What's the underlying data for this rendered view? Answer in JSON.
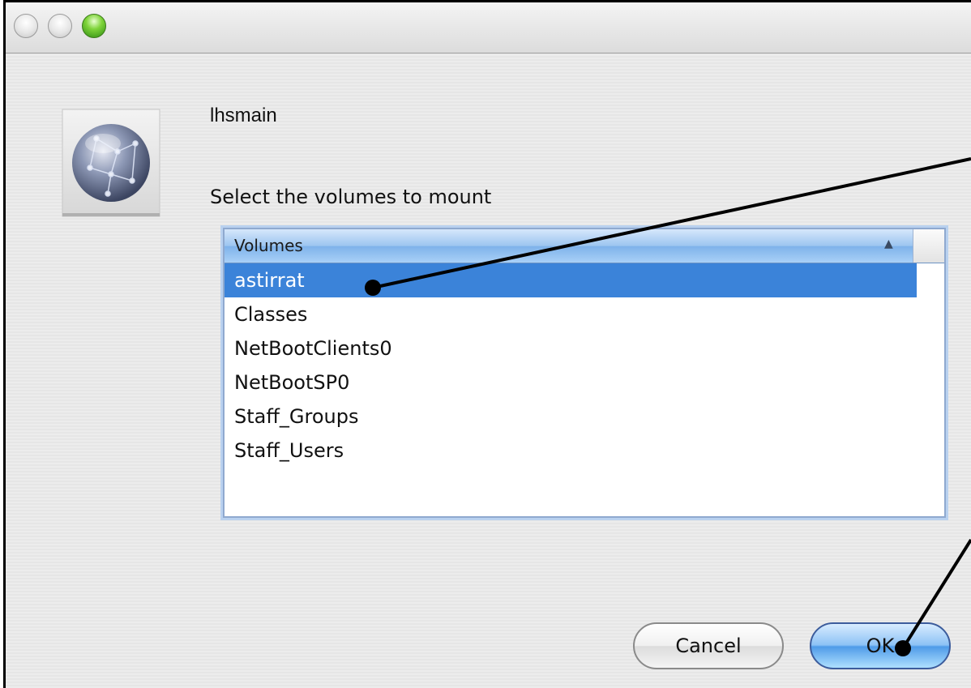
{
  "window": {
    "controls": [
      "close",
      "minimize",
      "zoom"
    ]
  },
  "dialog": {
    "server_name": "lhsmain",
    "prompt": "Select the volumes to mount",
    "icon": "network-globe-icon"
  },
  "volumes_list": {
    "header": "Volumes",
    "sort_indicator": "▲",
    "items": [
      {
        "label": "astirrat",
        "selected": true
      },
      {
        "label": "Classes",
        "selected": false
      },
      {
        "label": "NetBootClients0",
        "selected": false
      },
      {
        "label": "NetBootSP0",
        "selected": false
      },
      {
        "label": "Staff_Groups",
        "selected": false
      },
      {
        "label": "Staff_Users",
        "selected": false
      }
    ]
  },
  "buttons": {
    "cancel": "Cancel",
    "ok": "OK"
  },
  "colors": {
    "selection": "#3b83d9",
    "zoom_button": "#7fd43a",
    "default_button": "#4f9be8"
  }
}
